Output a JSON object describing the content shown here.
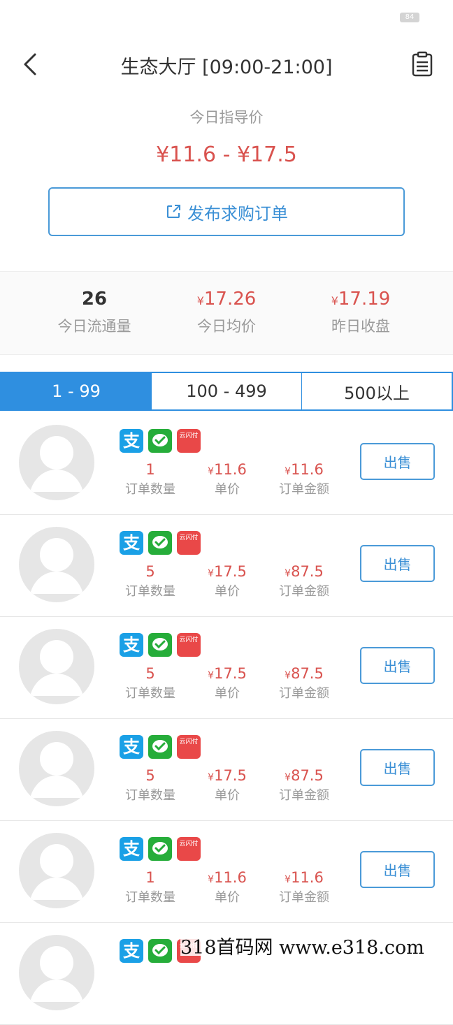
{
  "status": {
    "battery": "84"
  },
  "header": {
    "title": "生态大厅 [09:00-21:00]"
  },
  "guide": {
    "label": "今日指导价",
    "price": "¥11.6 - ¥17.5"
  },
  "publish_button": {
    "label": "发布求购订单"
  },
  "stats": [
    {
      "currency": "",
      "value": "26",
      "label": "今日流通量"
    },
    {
      "currency": "¥",
      "value": "17.26",
      "label": "今日均价"
    },
    {
      "currency": "¥",
      "value": "17.19",
      "label": "昨日收盘"
    }
  ],
  "tabs": [
    {
      "label": "1 - 99",
      "active": true
    },
    {
      "label": "100 - 499",
      "active": false
    },
    {
      "label": "500以上",
      "active": false
    }
  ],
  "column_labels": {
    "count": "订单数量",
    "price": "单价",
    "amount": "订单金额"
  },
  "payment_icons": {
    "alipay": "支",
    "unionpay": "云闪付"
  },
  "currency_symbol": "¥",
  "sell_label": "出售",
  "orders": [
    {
      "count": "1",
      "price": "11.6",
      "amount": "11.6"
    },
    {
      "count": "5",
      "price": "17.5",
      "amount": "87.5"
    },
    {
      "count": "5",
      "price": "17.5",
      "amount": "87.5"
    },
    {
      "count": "5",
      "price": "17.5",
      "amount": "87.5"
    },
    {
      "count": "1",
      "price": "11.6",
      "amount": "11.6"
    },
    {
      "count": "",
      "price": "",
      "amount": ""
    }
  ],
  "watermark": "318首码网  www.e318.com"
}
